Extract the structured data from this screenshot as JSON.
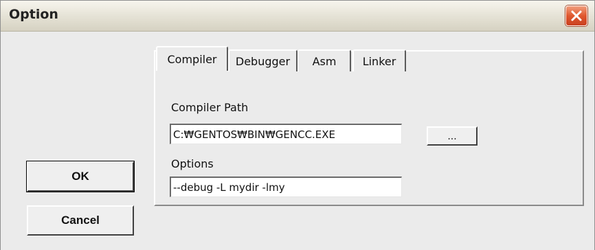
{
  "window": {
    "title": "Option"
  },
  "tabs": [
    {
      "label": "Compiler",
      "active": true
    },
    {
      "label": "Debugger",
      "active": false
    },
    {
      "label": "Asm",
      "active": false
    },
    {
      "label": "Linker",
      "active": false
    }
  ],
  "compiler": {
    "path_label": "Compiler Path",
    "path_value": "C:₩GENTOS₩BIN₩GENCC.EXE",
    "browse_label": "...",
    "options_label": "Options",
    "options_value": "--debug -L mydir -lmy"
  },
  "buttons": {
    "ok": "OK",
    "cancel": "Cancel"
  },
  "colors": {
    "close_button": "#e0582f",
    "dialog_background": "#ebebeb"
  },
  "icons": {
    "close": "close-icon"
  }
}
